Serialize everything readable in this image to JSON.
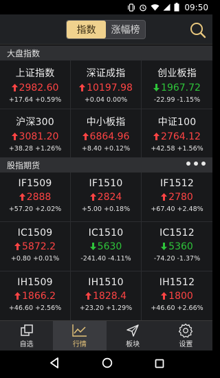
{
  "status_bar": {
    "time": "09:50"
  },
  "header": {
    "tabs": [
      {
        "label": "指数",
        "active": true
      },
      {
        "label": "涨幅榜",
        "active": false
      }
    ]
  },
  "sections": {
    "market": "大盘指数",
    "futures": "股指期货"
  },
  "market_indices": [
    {
      "name": "上证指数",
      "price": "2982.60",
      "dir": "up",
      "change": "+17.64 +0.59%"
    },
    {
      "name": "深证成指",
      "price": "10197.98",
      "dir": "up",
      "change": "+0.04 0.00%"
    },
    {
      "name": "创业板指",
      "price": "1967.72",
      "dir": "down",
      "change": "-22.99 -1.15%"
    },
    {
      "name": "沪深300",
      "price": "3081.20",
      "dir": "up",
      "change": "+38.28 +1.26%"
    },
    {
      "name": "中小板指",
      "price": "6864.96",
      "dir": "up",
      "change": "+8.40 +0.12%"
    },
    {
      "name": "中证100",
      "price": "2764.12",
      "dir": "up",
      "change": "+42.58 +1.56%"
    }
  ],
  "futures": [
    {
      "name": "IF1509",
      "price": "2888",
      "dir": "up",
      "change": "+57.20 +2.02%"
    },
    {
      "name": "IF1510",
      "price": "2824",
      "dir": "up",
      "change": "+5.00 +0.18%"
    },
    {
      "name": "IF1512",
      "price": "2780",
      "dir": "up",
      "change": "+67.40 +2.48%"
    },
    {
      "name": "IC1509",
      "price": "5872.2",
      "dir": "up",
      "change": "+0.80 +0.01%"
    },
    {
      "name": "IC1510",
      "price": "5630",
      "dir": "down",
      "change": "-241.40 -4.11%"
    },
    {
      "name": "IC1512",
      "price": "5360",
      "dir": "down",
      "change": "-74.20 -1.37%"
    },
    {
      "name": "IH1509",
      "price": "1866.2",
      "dir": "up",
      "change": "+46.60 +2.56%"
    },
    {
      "name": "IH1510",
      "price": "1828.4",
      "dir": "up",
      "change": "+23.20 +1.29%"
    },
    {
      "name": "IH1512",
      "price": "1800",
      "dir": "up",
      "change": "+46.60 +2.66%"
    }
  ],
  "bottom_nav": [
    {
      "label": "自选",
      "icon": "watchlist-icon",
      "active": false
    },
    {
      "label": "行情",
      "icon": "market-chart-icon",
      "active": true
    },
    {
      "label": "板块",
      "icon": "sector-send-icon",
      "active": false
    },
    {
      "label": "设置",
      "icon": "gear-icon",
      "active": false
    }
  ],
  "colors": {
    "up": "#ff4444",
    "down": "#2ec43a",
    "accent": "#f0d28e",
    "nav_active": "#e6c47a"
  }
}
